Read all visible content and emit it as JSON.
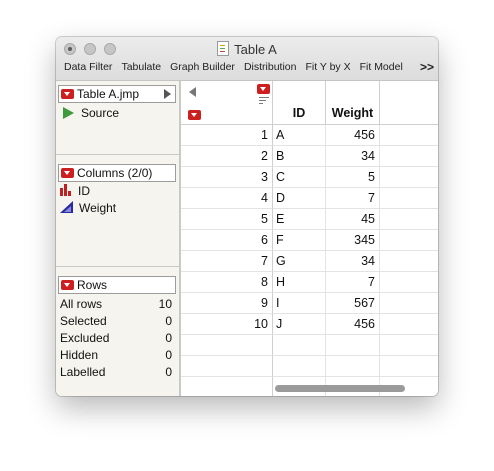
{
  "window": {
    "title": "Table A"
  },
  "toolbar": {
    "items": [
      "Data Filter",
      "Tabulate",
      "Graph Builder",
      "Distribution",
      "Fit Y by X",
      "Fit Model"
    ],
    "more": ">>"
  },
  "table_panel": {
    "name": "Table A.jmp",
    "items": [
      {
        "label": "Source",
        "icon": "script-triangle-icon"
      }
    ]
  },
  "columns_panel": {
    "header": "Columns (2/0)",
    "items": [
      {
        "label": "ID",
        "icon": "nominal-bars-icon"
      },
      {
        "label": "Weight",
        "icon": "continuous-ramp-icon"
      }
    ]
  },
  "rows_panel": {
    "header": "Rows",
    "stats": [
      {
        "label": "All rows",
        "value": "10"
      },
      {
        "label": "Selected",
        "value": "0"
      },
      {
        "label": "Excluded",
        "value": "0"
      },
      {
        "label": "Hidden",
        "value": "0"
      },
      {
        "label": "Labelled",
        "value": "0"
      }
    ]
  },
  "grid": {
    "columns": [
      "ID",
      "Weight"
    ],
    "rows": [
      {
        "n": "1",
        "id": "A",
        "weight": "456"
      },
      {
        "n": "2",
        "id": "B",
        "weight": "34"
      },
      {
        "n": "3",
        "id": "C",
        "weight": "5"
      },
      {
        "n": "4",
        "id": "D",
        "weight": "7"
      },
      {
        "n": "5",
        "id": "E",
        "weight": "45"
      },
      {
        "n": "6",
        "id": "F",
        "weight": "345"
      },
      {
        "n": "7",
        "id": "G",
        "weight": "34"
      },
      {
        "n": "8",
        "id": "H",
        "weight": "7"
      },
      {
        "n": "9",
        "id": "I",
        "weight": "567"
      },
      {
        "n": "10",
        "id": "J",
        "weight": "456"
      }
    ]
  },
  "colors": {
    "red_button": "#cc2020",
    "sidebar_bg": "#f5f4ee"
  }
}
